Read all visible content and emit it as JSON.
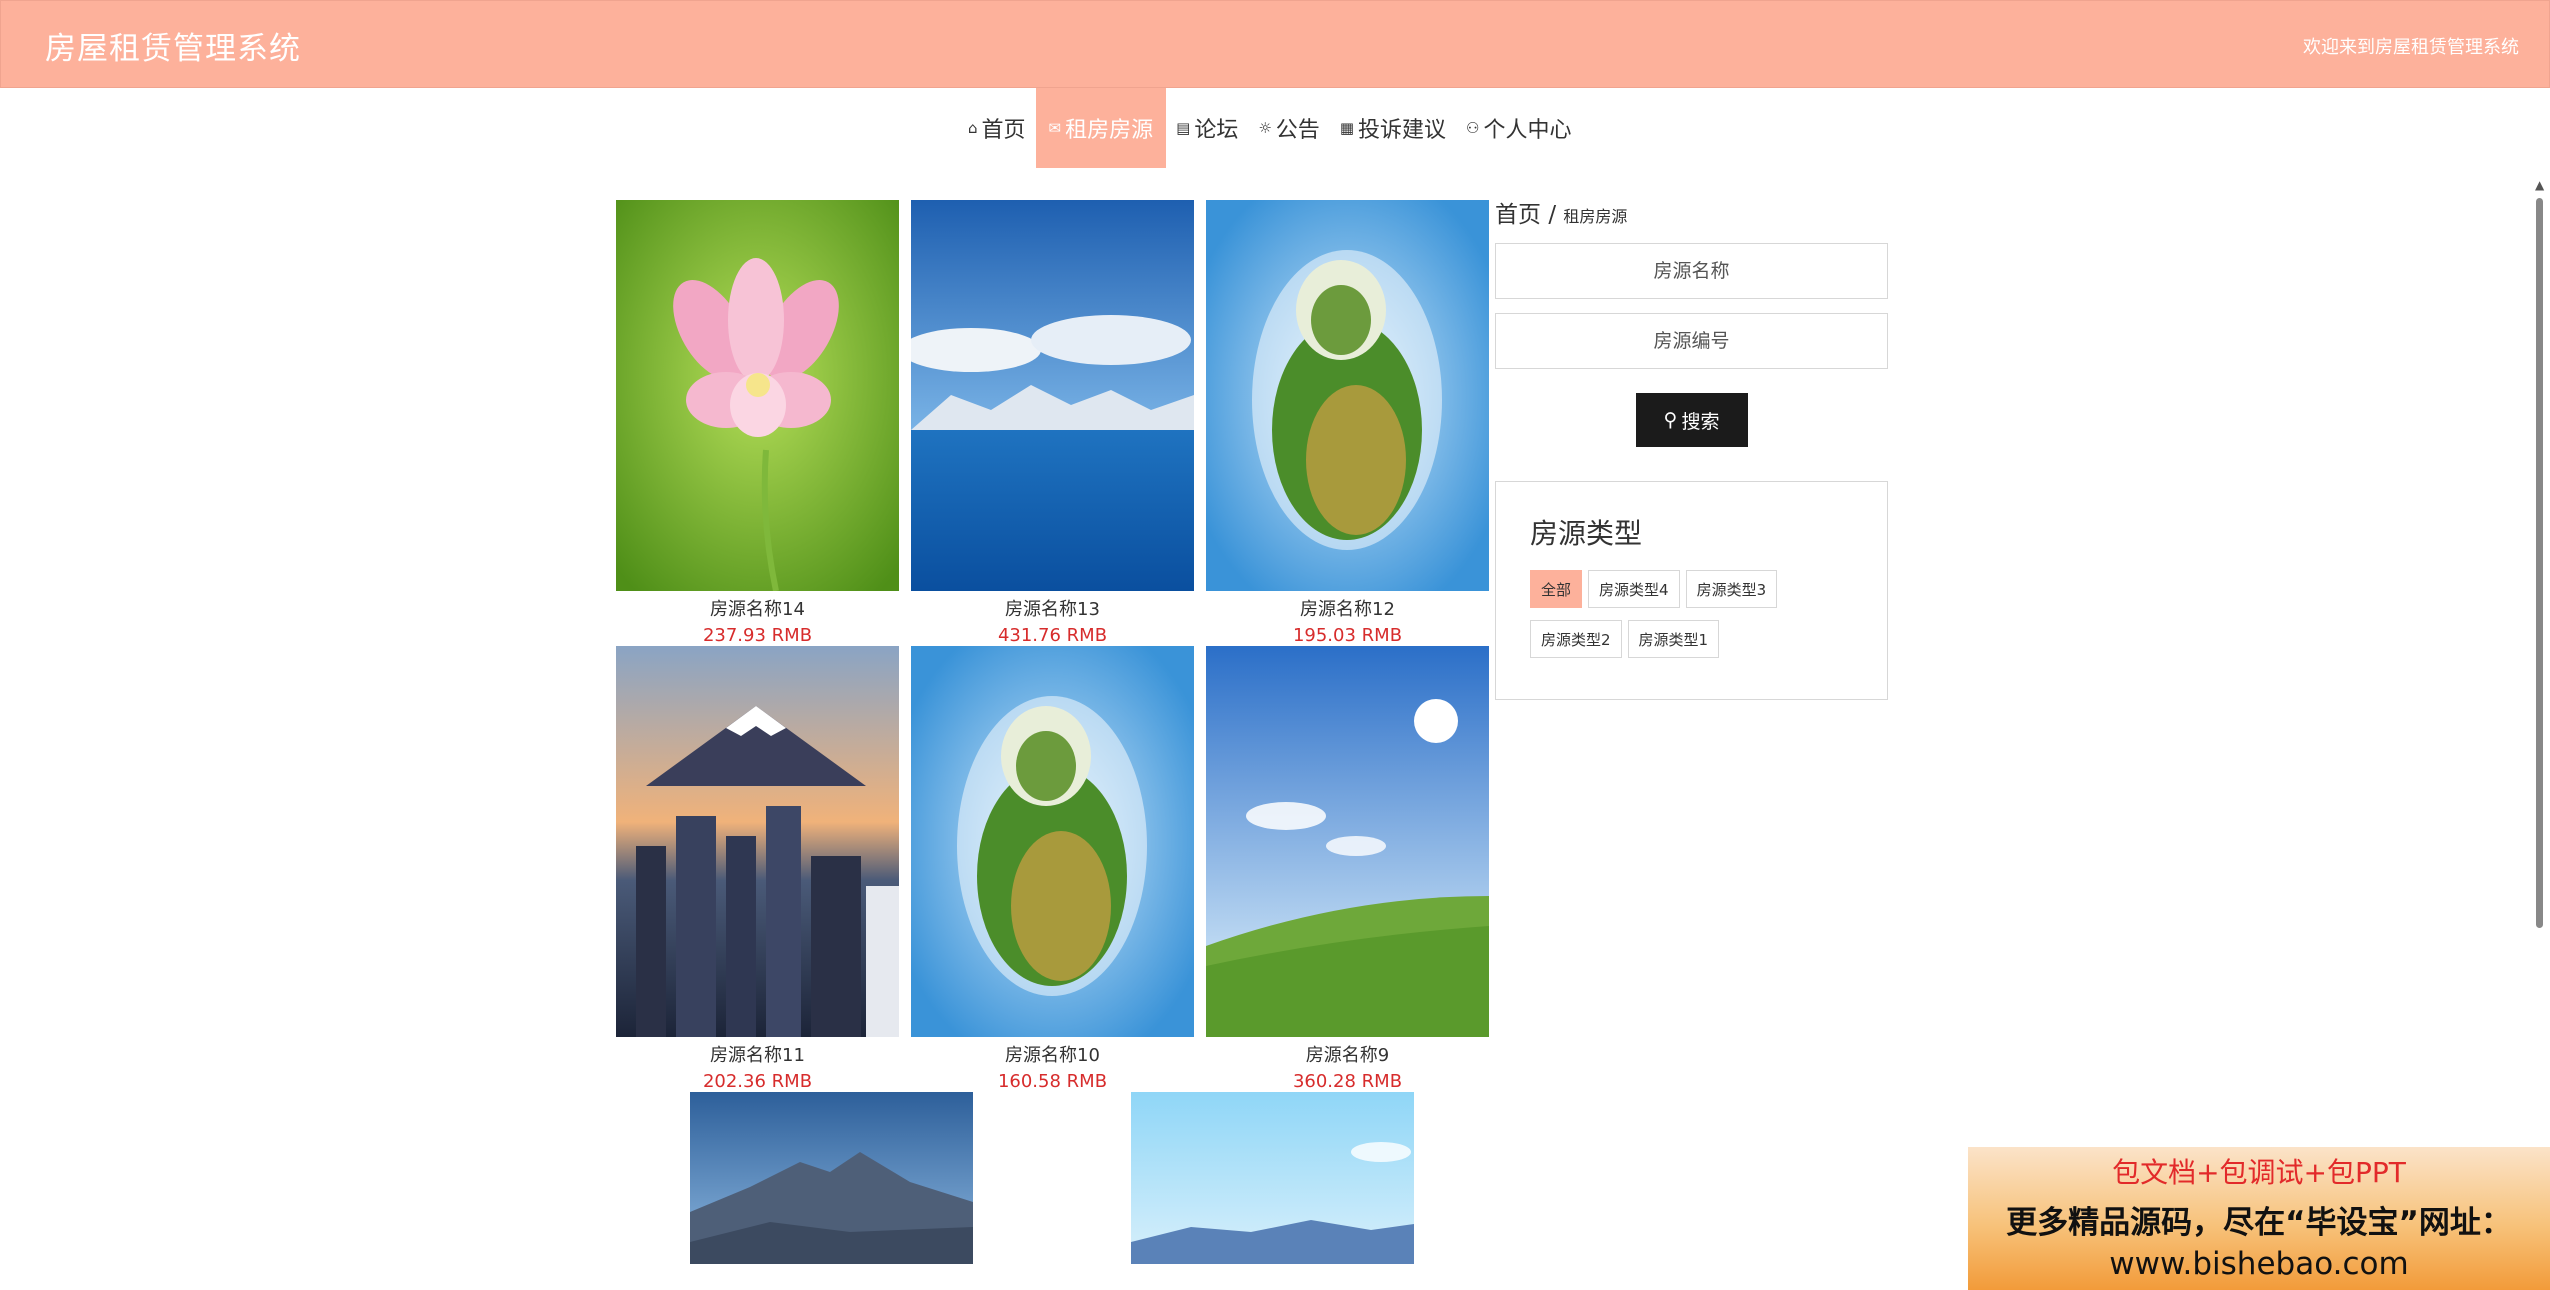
{
  "header": {
    "title": "房屋租赁管理系统",
    "welcome": "欢迎来到房屋租赁管理系统"
  },
  "nav": {
    "items": [
      {
        "icon": "home-icon",
        "label": "首页"
      },
      {
        "icon": "mail-icon",
        "label": "租房房源"
      },
      {
        "icon": "forum-icon",
        "label": "论坛"
      },
      {
        "icon": "gear-icon",
        "label": "公告"
      },
      {
        "icon": "grid-icon",
        "label": "投诉建议"
      },
      {
        "icon": "user-icon",
        "label": "个人中心"
      }
    ],
    "active": "租房房源"
  },
  "listings": [
    {
      "name": "房源名称14",
      "price": "237.93 RMB",
      "image": "lotus"
    },
    {
      "name": "房源名称13",
      "price": "431.76 RMB",
      "image": "lake"
    },
    {
      "name": "房源名称12",
      "price": "195.03 RMB",
      "image": "planet"
    },
    {
      "name": "房源名称11",
      "price": "202.36 RMB",
      "image": "city"
    },
    {
      "name": "房源名称10",
      "price": "160.58 RMB",
      "image": "planet"
    },
    {
      "name": "房源名称9",
      "price": "360.28 RMB",
      "image": "meadow"
    },
    {
      "name": "",
      "price": "",
      "image": "mountain"
    },
    {
      "name": "",
      "price": "",
      "image": "sky"
    }
  ],
  "sidebar": {
    "breadcrumb_home": "首页",
    "breadcrumb_sep": "/",
    "breadcrumb_current": "租房房源",
    "name_placeholder": "房源名称",
    "code_placeholder": "房源编号",
    "search_label": "搜索",
    "types_title": "房源类型",
    "types": [
      "全部",
      "房源类型4",
      "房源类型3",
      "房源类型2",
      "房源类型1"
    ],
    "active_type": "全部"
  },
  "ad": {
    "line1": "包文档+包调试+包PPT",
    "line2": "更多精品源码，尽在“毕设宝”网址：",
    "line3": "www.bishebao.com"
  },
  "colors": {
    "accent": "#fdb19b",
    "price": "#d72c2c",
    "button": "#1b1b1b"
  }
}
